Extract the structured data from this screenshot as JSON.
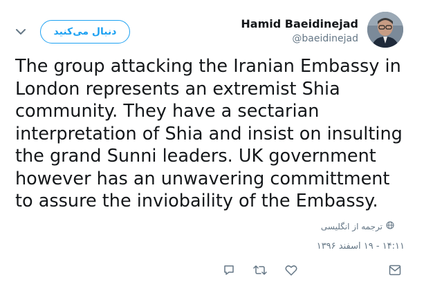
{
  "author": {
    "name": "Hamid Baeidinejad",
    "handle": "@baeidinejad"
  },
  "follow_label": "دنبال می‌کنید",
  "tweet_text": "The group attacking the Iranian Embassy in London represents an extremist Shia community. They have a sectarian interpretation of Shia and insist on insulting the grand Sunni leaders. UK government however has an unwavering committment to assure the inviobaility of the Embassy.",
  "translate_label": "ترجمه از انگلیسی",
  "timestamp": "۱۴:۱۱ - ۱۹ اسفند ۱۳۹۶",
  "icons": {
    "menu": "chevron-down-icon",
    "translate": "globe-icon",
    "reply": "reply-icon",
    "retweet": "retweet-icon",
    "like": "heart-icon",
    "message": "message-icon"
  },
  "colors": {
    "accent": "#1da1f2",
    "text": "#14171a",
    "secondary": "#657786"
  }
}
